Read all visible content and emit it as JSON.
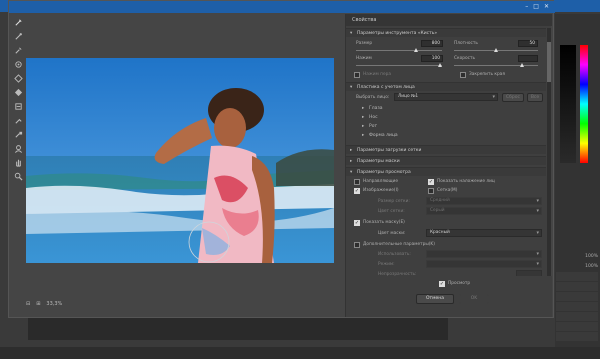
{
  "photoshop": {
    "status_bar": "",
    "right_panel": {
      "rows": [
        {
          "label": "",
          "value": "100%"
        },
        {
          "label": "",
          "value": "100%"
        }
      ]
    }
  },
  "dialog": {
    "title": "",
    "title_controls": [
      "–",
      "□",
      "✕"
    ],
    "zoom": "33,3%",
    "panel": {
      "title": "Свойства",
      "sections": {
        "tool_params": "Параметры инструмента «Кисть»",
        "face_aware": "Пластика с учетом лица",
        "eyes": "Параметры загрузки сетки",
        "mask": "Параметры маски",
        "view": "Параметры просмотра",
        "brush_reconstruct": "Дополнительные параметры"
      },
      "brush": {
        "size_label": "Размер",
        "size_value": "800",
        "density_label": "Плотность",
        "density_value": "50",
        "pressure_label": "Нажим",
        "pressure_value": "100",
        "rate_label": "Скорость",
        "rate_value": "",
        "stylus_label": "Нажим пера",
        "pin_edges_label": "Закрепить края"
      },
      "face": {
        "select_label": "Выбрать лицо:",
        "select_value": "Лицо №1",
        "reset_label": "Сброс",
        "all_label": "Все",
        "items": [
          "Глаза",
          "Нос",
          "Рот",
          "Форма лица"
        ]
      },
      "view": {
        "show_guides_label": "Направляющие",
        "show_face_overlay_label": "Показать наложение лиц",
        "show_image_label": "Изображение(I)",
        "show_mesh_label": "Сетка(M)",
        "mesh_size_label": "Размер сетки:",
        "mesh_size_value": "Средний",
        "mesh_color_label": "Цвет сетки:",
        "mesh_color_value": "Серый",
        "show_mask_label": "Показать маску(E)",
        "mask_color_label": "Цвет маски:",
        "mask_color_value": "Красный",
        "show_backdrop_label": "Дополнительные параметры(K)",
        "use_label": "Использовать:",
        "use_value": "",
        "mode_label": "Режим:",
        "mode_value": "",
        "opacity_label": "Непрозрачность:",
        "opacity_value": ""
      },
      "preview_label": "Просмотр",
      "cancel_label": "Отмена",
      "ok_label": "OK"
    }
  },
  "colors": {
    "accent": "#1e5fa8",
    "panel_bg": "#3f3f3f",
    "dialog_bg": "#454545"
  }
}
